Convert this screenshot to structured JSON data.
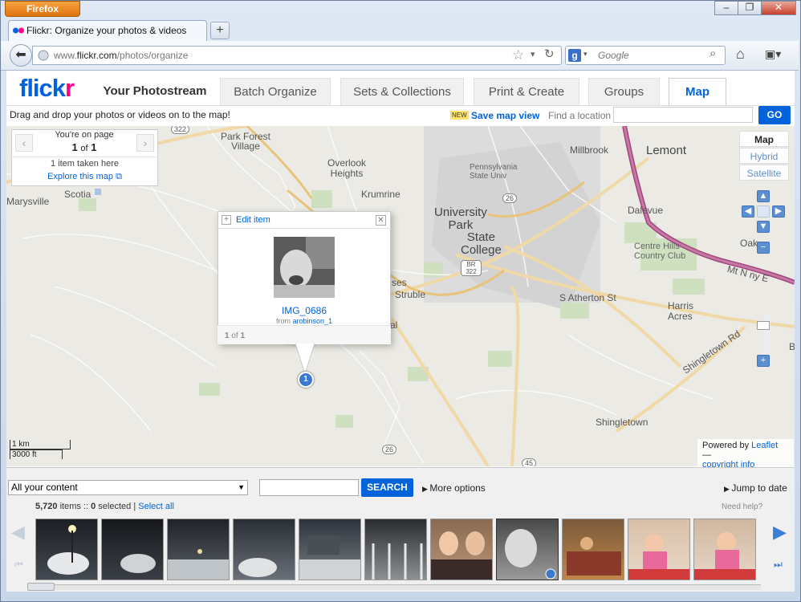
{
  "browser": {
    "app_button": "Firefox",
    "tab_title": "Flickr: Organize your photos & videos",
    "new_tab": "+",
    "url_prefix": "www.",
    "url_domain": "flickr.com",
    "url_path": "/photos/organize",
    "search_placeholder": "Google",
    "window_controls": [
      "–",
      "❐",
      "✕"
    ]
  },
  "flickr": {
    "logo_a": "flick",
    "logo_b": "r",
    "nav": [
      "Your Photostream",
      "Batch Organize",
      "Sets & Collections",
      "Print & Create",
      "Groups",
      "Map"
    ],
    "active_tab": "Map",
    "instructions": "Drag and drop your photos or videos on to the map!",
    "new_badge": "NEW",
    "save_map_view": "Save map view",
    "find_location_label": "Find a location",
    "go_label": "GO"
  },
  "map": {
    "pager": {
      "label": "You're on page",
      "current": "1",
      "of": "of",
      "total": "1"
    },
    "taken_here": "1 item taken here",
    "explore": "Explore this map",
    "types": [
      "Map",
      "Hybrid",
      "Satellite"
    ],
    "active_type": "Map",
    "labels": {
      "park_forest_village": "Park Forest\nVillage",
      "overlook_heights": "Overlook\nHeights",
      "krumrine": "Krumrine",
      "scotia": "Scotia",
      "marysville": "Marysville",
      "pennsylvania_state_univ": "Pennsylvania\nState Univ",
      "university_park": "University\nPark",
      "state_college": "State\nCollege",
      "millbrook": "Millbrook",
      "lemont": "Lemont",
      "dalevue": "Dalevue",
      "oak": "Oak",
      "centre_hills": "Centre Hills\nCountry Club",
      "mt_nittany": "Mt N    ny E",
      "s_atherton": "S Atherton St",
      "harris_acres": "Harris\nAcres",
      "struble": "Struble",
      "shingletown_rd": "Shingletown Rd",
      "shingletown": "Shingletown",
      "route_322": "322",
      "route_26": "26",
      "br_322": "BR 322",
      "route_45": "45",
      "ses": "ses",
      "al": "al",
      "b": "B"
    },
    "scale_km": "1 km",
    "scale_ft": "3000 ft",
    "powered_by": "Powered by",
    "leaflet": "Leaflet",
    "copyright": "copyright info",
    "popup": {
      "edit_item": "Edit item",
      "title": "IMG_0686",
      "from_label": "from",
      "owner": "arobinson_1",
      "count_current": "1",
      "count_of": "of",
      "count_total": "1"
    },
    "pin_number": "1"
  },
  "organizer": {
    "content_filter": "All your content",
    "search_button": "SEARCH",
    "more_options": "More options",
    "jump_to_date": "Jump to date",
    "items_count": "5,720",
    "items_label": "items ::",
    "selected_count": "0",
    "selected_label": "selected |",
    "select_all": "Select all",
    "need_help": "Need help?"
  },
  "colors": {
    "flickr_blue": "#0063dc",
    "flickr_pink": "#ff0084",
    "map_bg": "#eceae4",
    "route_purple": "#a3447e"
  }
}
